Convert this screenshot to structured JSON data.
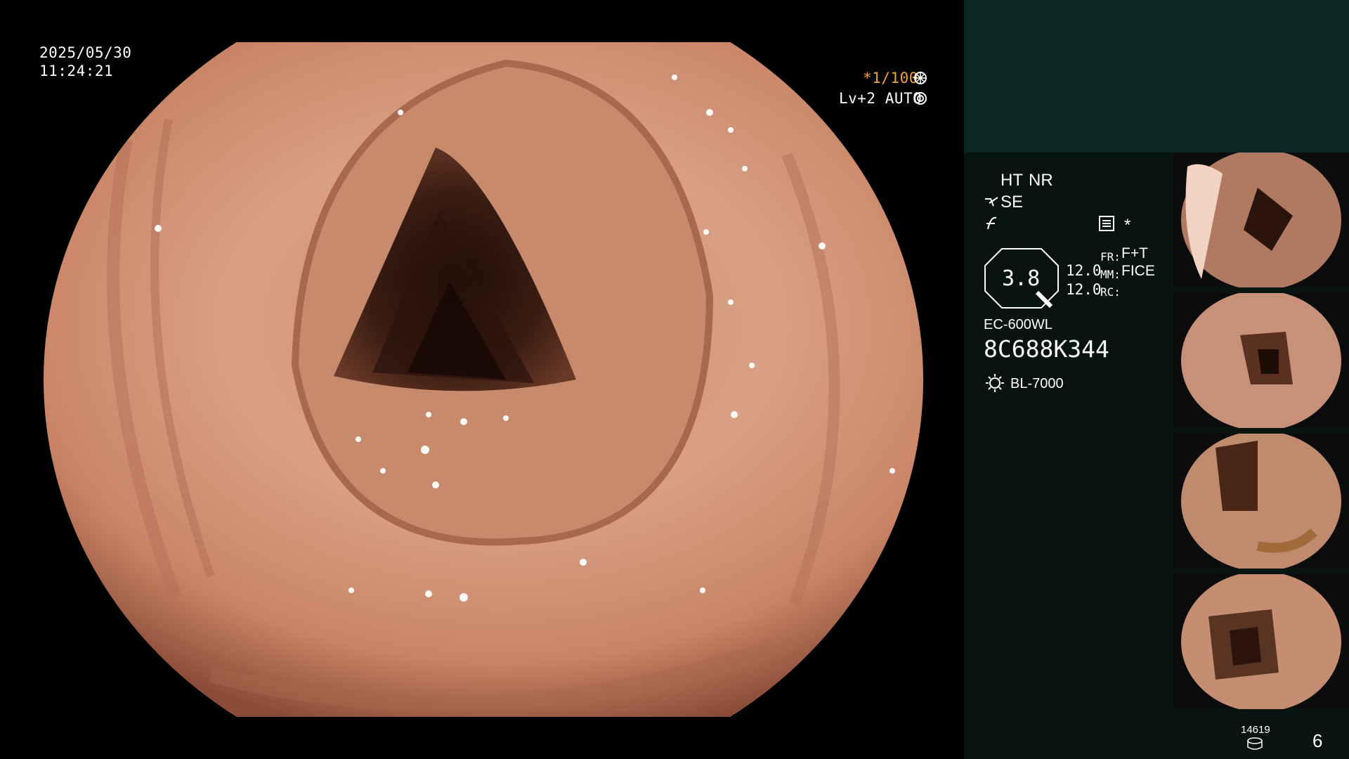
{
  "osd": {
    "date": "2025/05/30",
    "time": "11:24:21",
    "shutter": "*1/100",
    "shutter_icon": "aperture-icon",
    "exposure": "Lv+2 AUTO",
    "exposure_icon": "target-icon"
  },
  "panel": {
    "ht_label": "HT",
    "nr_label": "NR",
    "se_label": "SE",
    "se_icon": "enhance-icon",
    "f_icon": "f-curve-icon",
    "settings_icon": "list-settings-icon",
    "asterisk": "*",
    "zoom_value": "3.8",
    "val1": "12.0",
    "val2": "12.0",
    "fr_label": "FR:",
    "fr_value": "F+T",
    "mm_label": "MM:",
    "mm_value": "FICE",
    "rc_label": "RC:",
    "scope_model": "EC-600WL",
    "serial": "8C688K344",
    "light_icon": "sun-icon",
    "light_source": "BL-7000",
    "count_top": "14619",
    "count_icon": "storage-icon",
    "page_number": "6"
  },
  "colors": {
    "panel_bg": "#081412",
    "panel_top": "#0c2624",
    "accent_orange": "#f0a23a",
    "tissue": "#d49478"
  }
}
